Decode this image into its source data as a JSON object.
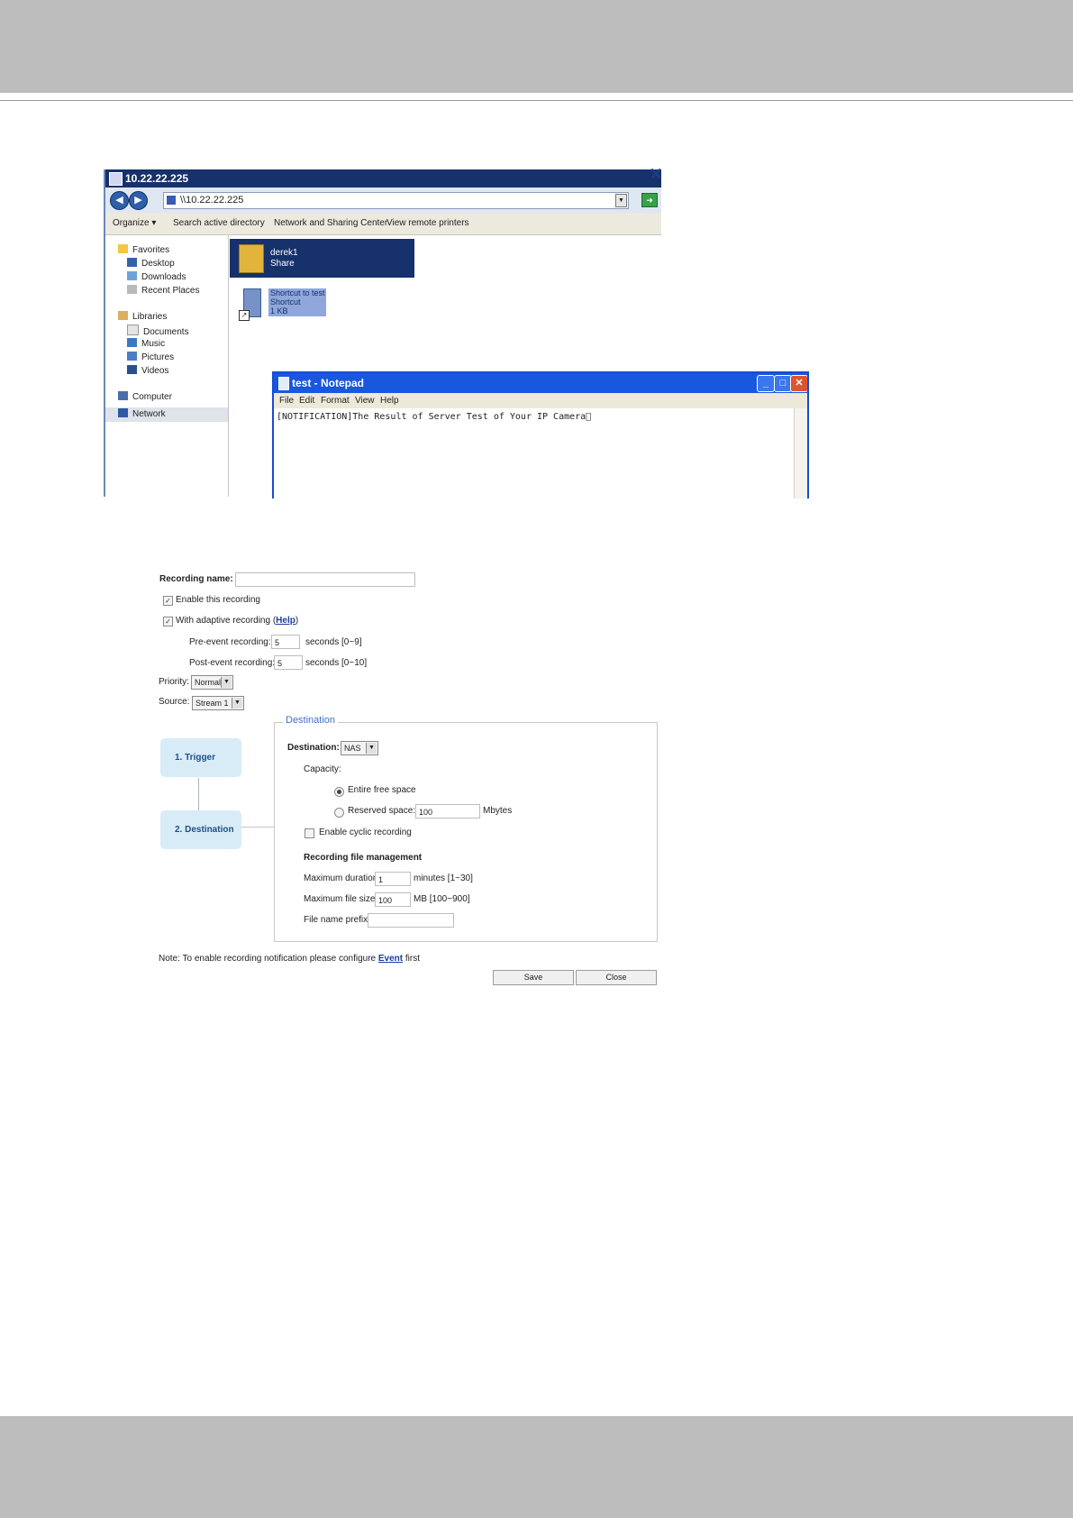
{
  "explorer": {
    "title": "10.22.22.225",
    "address": "\\\\10.22.22.225",
    "close_glyph": "✕",
    "toolbar": [
      "Organize ▾",
      "Search active directory",
      "Network and Sharing Center",
      "View remote printers"
    ],
    "nav": {
      "favorites": "Favorites",
      "desktop": "Desktop",
      "downloads": "Downloads",
      "recent": "Recent Places",
      "libraries": "Libraries",
      "documents": "Documents",
      "music": "Music",
      "pictures": "Pictures",
      "videos": "Videos",
      "computer": "Computer",
      "network": "Network"
    },
    "items": {
      "share_name": "derek1",
      "share_type": "Share",
      "shortcut_name": "Shortcut to test",
      "shortcut_type": "Shortcut",
      "shortcut_size": "1 KB"
    }
  },
  "notepad": {
    "title": "test - Notepad",
    "menu": [
      "File",
      "Edit",
      "Format",
      "View",
      "Help"
    ],
    "content": "[NOTIFICATION]The Result of Server Test of Your IP Camera\u0000"
  },
  "form": {
    "recording_name_label": "Recording name:",
    "enable_label": "Enable this recording",
    "adaptive_label": "With adaptive recording (",
    "help_link": "Help",
    "adaptive_close": ")",
    "pre_event_label": "Pre-event recording:",
    "pre_event_value": "5",
    "pre_event_unit": "seconds [0~9]",
    "post_event_label": "Post-event recording:",
    "post_event_value": "5",
    "post_event_unit": "seconds [0~10]",
    "priority_label": "Priority:",
    "priority_value": "Normal",
    "source_label": "Source:",
    "source_value": "Stream 1",
    "step1": "1.  Trigger",
    "step2": "2.  Destination",
    "legend": "Destination",
    "destination_label": "Destination:",
    "destination_value": "NAS",
    "capacity_label": "Capacity:",
    "entire_label": "Entire free space",
    "reserved_label": "Reserved space:",
    "reserved_value": "100",
    "reserved_unit": "Mbytes",
    "cyclic_label": "Enable cyclic recording",
    "file_mgmt_label": "Recording file management",
    "max_duration_label": "Maximum duration:",
    "max_duration_value": "1",
    "max_duration_unit": "minutes [1~30]",
    "max_size_label": "Maximum file size:",
    "max_size_value": "100",
    "max_size_unit": "MB [100~900]",
    "prefix_label": "File name prefix:",
    "prefix_value": "",
    "note_text": "Note: To enable recording notification please configure ",
    "note_link": "Event",
    "note_end": " first",
    "save": "Save",
    "close": "Close"
  },
  "icons": [
    "back-icon",
    "forward-icon",
    "network-flag-icon",
    "go-icon",
    "star-icon",
    "folder-icon",
    "document-icon",
    "shortcut-arrow-icon",
    "notepad-icon",
    "minimize-icon",
    "maximize-icon",
    "close-icon",
    "checkbox-checked-icon",
    "dropdown-arrow-icon"
  ]
}
